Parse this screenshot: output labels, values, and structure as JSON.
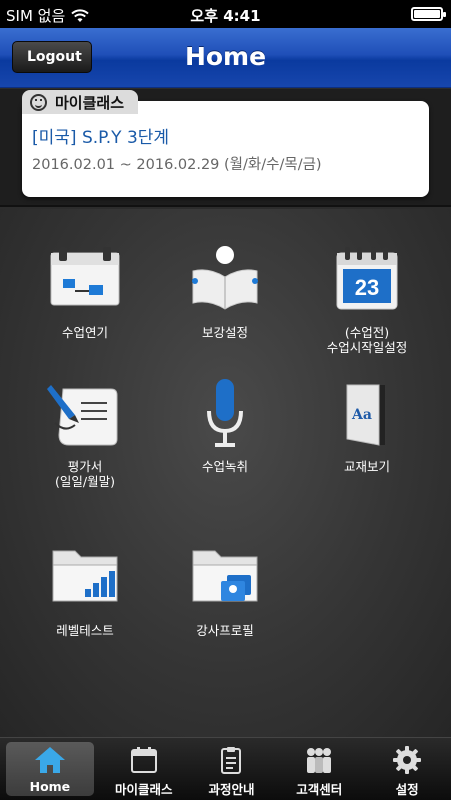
{
  "status_bar": {
    "carrier": "SIM 없음",
    "time": "오후 4:41",
    "battery_level": 1.0
  },
  "header": {
    "title": "Home",
    "logout_label": "Logout"
  },
  "my_class": {
    "tab_label": "마이클래스",
    "course_name": "[미국] S.P.Y 3단계",
    "course_period": "2016.02.01 ~ 2016.02.29 (월/화/수/목/금)"
  },
  "menu": {
    "postpone": {
      "label": "수업연기",
      "icon": "board-icon"
    },
    "makeup": {
      "label": "보강설정",
      "icon": "reading-person-icon"
    },
    "start_date": {
      "label_line1": "(수업전)",
      "label_line2": "수업시작일설정",
      "icon": "calendar-icon",
      "calendar_day": "23"
    },
    "evaluation": {
      "label_line1": "평가서",
      "label_line2": "(일일/월말)",
      "icon": "document-pen-icon"
    },
    "recording": {
      "label": "수업녹취",
      "icon": "microphone-icon"
    },
    "textbook": {
      "label": "교재보기",
      "icon": "book-icon",
      "book_text": "Aa"
    },
    "level_test": {
      "label": "레벨테스트",
      "icon": "folder-chart-icon"
    },
    "tutor_profile": {
      "label": "강사프로필",
      "icon": "folder-profile-icon"
    }
  },
  "tabbar": {
    "home": "Home",
    "my_class": "마이클래스",
    "course_info": "과정안내",
    "support": "고객센터",
    "settings": "설정"
  },
  "colors": {
    "header_blue": "#1f4fb8",
    "accent_blue": "#1a5aa8"
  }
}
